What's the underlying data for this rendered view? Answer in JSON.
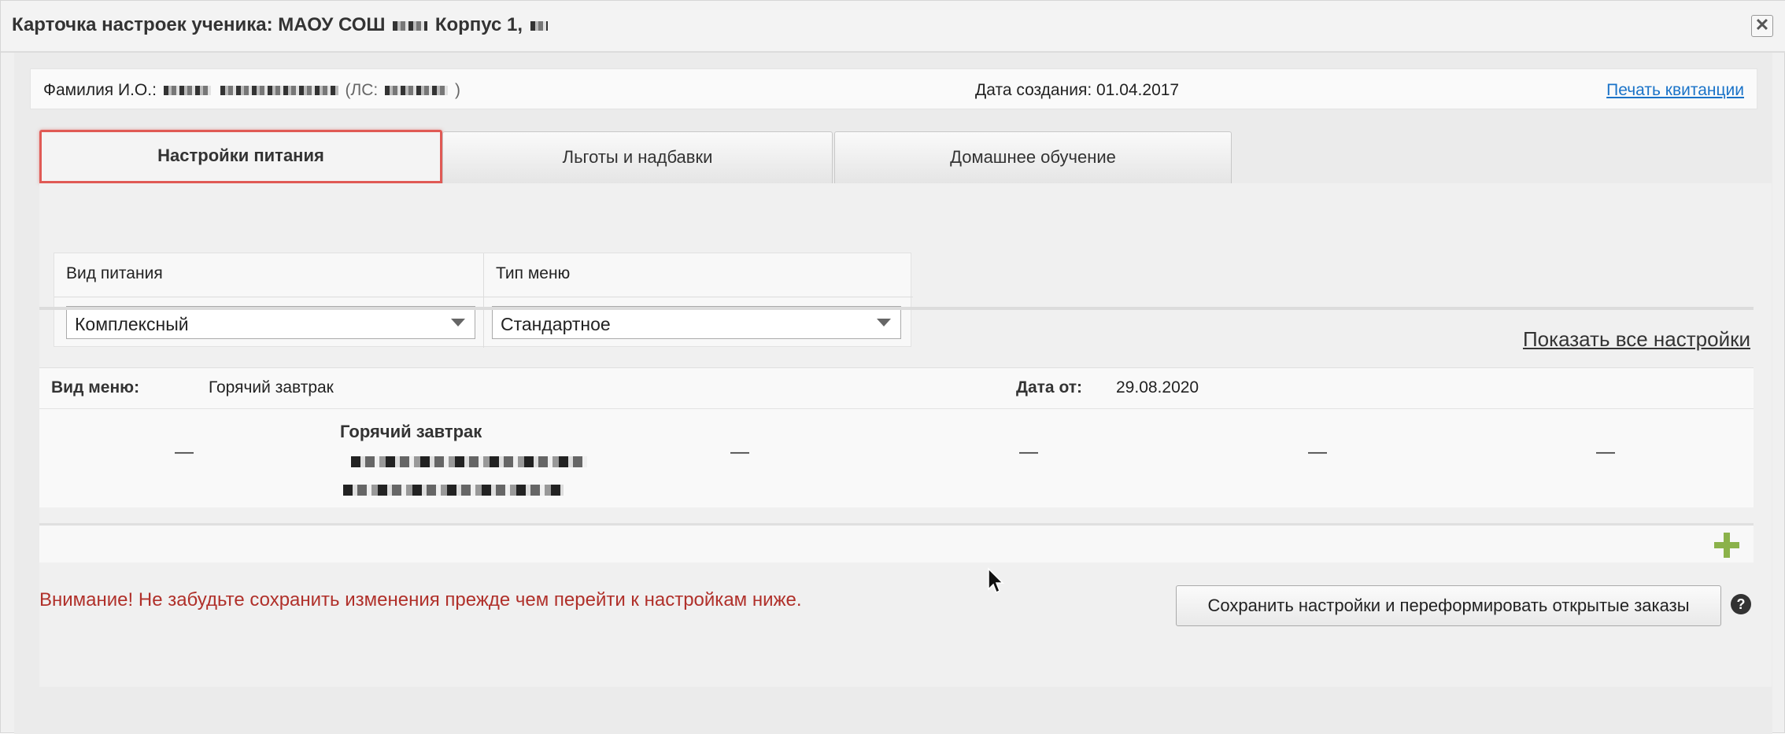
{
  "window": {
    "title": "Карточка настроек ученика: МАОУ СОШ",
    "title_suffix": "Корпус 1,",
    "close_label": "✕"
  },
  "info": {
    "fio_label": "Фамилия И.О.:",
    "ls_label": "(ЛС:",
    "ls_close": ")",
    "created_label": "Дата создания:",
    "created_value": "01.04.2017",
    "print_link": "Печать квитанции"
  },
  "tabs": [
    {
      "label": "Настройки питания",
      "active": true
    },
    {
      "label": "Льготы и надбавки",
      "active": false
    },
    {
      "label": "Домашнее обучение",
      "active": false
    }
  ],
  "filters": {
    "meal_kind_label": "Вид питания",
    "meal_kind_value": "Комплексный",
    "menu_type_label": "Тип меню",
    "menu_type_value": "Стандартное"
  },
  "show_all_link": "Показать все настройки",
  "menu": {
    "kind_label": "Вид меню:",
    "kind_value": "Горячий завтрак",
    "date_label": "Дата от:",
    "date_value": "29.08.2020",
    "dish_title": "Горячий завтрак",
    "dash": "—"
  },
  "warning": "Внимание! Не забудьте сохранить изменения прежде чем перейти к настройкам ниже.",
  "save_button": "Сохранить настройки и переформировать открытые заказы",
  "help_label": "?",
  "colors": {
    "active_tab_outline": "#e05a55",
    "link": "#1a73c8",
    "warning": "#b0302a",
    "plus": "#8bb24a"
  }
}
